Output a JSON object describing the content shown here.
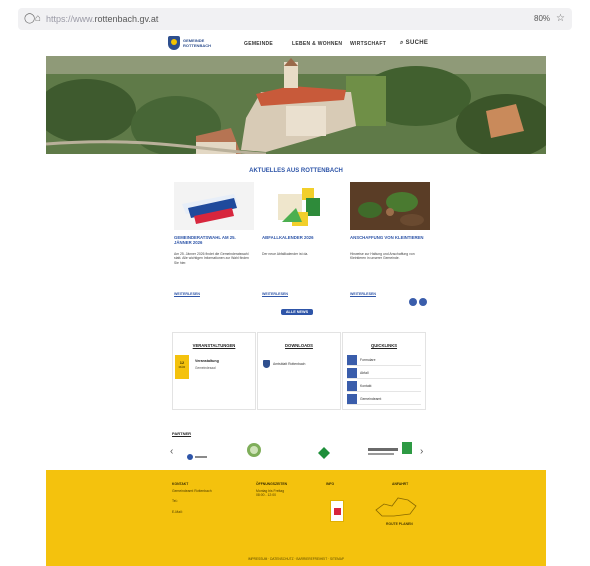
{
  "browser": {
    "url_host_dim": "https://www.",
    "url_host": "rottenbach.gv.at",
    "zoom": "80%"
  },
  "site": {
    "logo_line1": "GEMEINDE",
    "logo_line2": "ROTTENBACH",
    "nav": [
      "GEMEINDE",
      "LEBEN & WOHNEN",
      "WIRTSCHAFT"
    ],
    "search_label": "SUCHE"
  },
  "news": {
    "section_title": "AKTUELLES AUS ROTTENBACH",
    "cards": [
      {
        "title": "GEMEINDERATSWAHL AM 25. JÄNNER 2026",
        "text": "Am 25. Jänner 2026 findet die Gemeinderatswahl statt. Alle wichtigen Informationen zur Wahl finden Sie hier.",
        "more": "WEITERLESEN"
      },
      {
        "title": "ABFALLKALENDER 2026",
        "text": "Der neue Abfallkalender ist da.",
        "more": "WEITERLESEN"
      },
      {
        "title": "ANSCHAFFUNG VON KLEINTIEREN",
        "text": "Hinweise zur Haltung und Anschaffung von Kleintieren in unserer Gemeinde.",
        "more": "WEITERLESEN"
      }
    ],
    "all_button": "ALLE NEWS"
  },
  "panels": {
    "events_title": "VERANSTALTUNGEN",
    "event": {
      "day": "12",
      "month": "MÄR",
      "name": "Veranstaltung",
      "info": "Gemeindesaal"
    },
    "downloads_title": "DOWNLOADS",
    "download_item": "Amtsblatt Rottenbach",
    "quicklinks_title": "QUICKLINKS",
    "quicklinks": [
      "Formulare",
      "Abfall",
      "Kontakt",
      "Gemeindeamt"
    ]
  },
  "partners": {
    "title": "PARTNER",
    "prev": "‹",
    "next": "›"
  },
  "footer": {
    "col1_title": "KONTAKT",
    "col1_lines": [
      "Gemeindeamt Rottenbach",
      "Tel.:",
      "E-Mail:"
    ],
    "col2_title": "ÖFFNUNGSZEITEN",
    "col2_lines": [
      "Montag bis Freitag",
      "08:00 - 12:00"
    ],
    "col3_title": "INFO",
    "col4_title": "ANFAHRT",
    "col4_link": "ROUTE PLANEN",
    "bottom": "IMPRESSUM · DATENSCHUTZ · BARRIEREFREIHEIT · SITEMAP"
  },
  "colors": {
    "accent": "#2e55a8",
    "footer": "#f4c20d",
    "hero": "#5b7446"
  }
}
